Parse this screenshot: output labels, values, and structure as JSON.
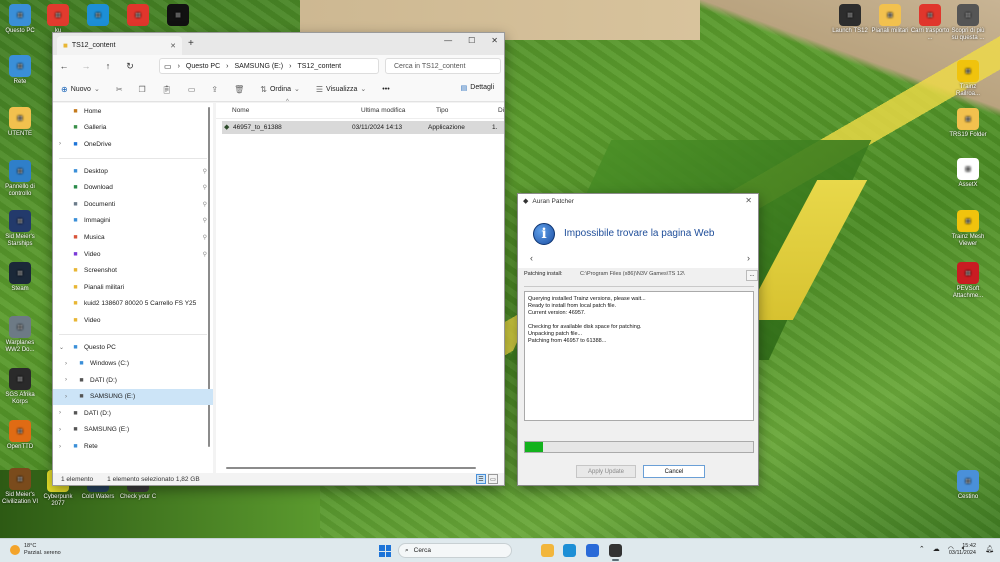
{
  "desktop": {
    "icons_left": [
      {
        "label": "Questo PC",
        "icon": "monitor-icon",
        "color": "#3a8fd8"
      },
      {
        "label": "Rete",
        "icon": "network-icon",
        "color": "#3a8fd8"
      },
      {
        "label": "UTENTE",
        "icon": "folder-icon",
        "color": "#f2c14e"
      },
      {
        "label": "Pannello di controllo",
        "icon": "control-panel-icon",
        "color": "#2f7fc9"
      },
      {
        "label": "Sid Meier's Starships",
        "icon": "starships-icon",
        "color": "#233a6b"
      },
      {
        "label": "Steam",
        "icon": "steam-icon",
        "color": "#1b2838"
      },
      {
        "label": "Warplanes WW2 Do...",
        "icon": "warplanes-icon",
        "color": "#6d7a85"
      },
      {
        "label": "SGS Afrika Korps",
        "icon": "sgs-icon",
        "color": "#2a2a2a"
      },
      {
        "label": "OpenTTD",
        "icon": "openttd-icon",
        "color": "#e06b14"
      },
      {
        "label": "Sid Meier's Civilization VI",
        "icon": "civ-icon",
        "color": "#7a4b1c"
      }
    ],
    "icons_top_row": [
      {
        "label": "ku",
        "icon": "anydesk-icon",
        "color": "#e23b2e"
      },
      {
        "label": "",
        "icon": "edge-icon",
        "color": "#1d8fd6"
      },
      {
        "label": "",
        "icon": "chrome-icon",
        "color": "#e0362c"
      },
      {
        "label": "",
        "icon": "logitech-icon",
        "color": "#111111"
      }
    ],
    "icons_bottom_row": [
      {
        "label": "Cyberpunk 2077",
        "icon": "cyberpunk-icon",
        "color": "#e9e12b"
      },
      {
        "label": "Cold Waters",
        "icon": "cold-waters-icon",
        "color": "#27435e"
      },
      {
        "label": "Check your C",
        "icon": "check-icon",
        "color": "#3b3b3b"
      }
    ],
    "icons_right": [
      {
        "label": "Launch TS12",
        "icon": "ts12-launcher-icon",
        "color": "#2d2d2d"
      },
      {
        "label": "Pianali militari",
        "icon": "folder-icon",
        "color": "#f2c14e"
      },
      {
        "label": "Carri trasporto ...",
        "icon": "chrome-icon",
        "color": "#e0362c"
      },
      {
        "label": "Scopri di più su questa ...",
        "icon": "spotlight-icon",
        "color": "#555555"
      },
      {
        "label": "Trainz Railroa...",
        "icon": "trainz-icon",
        "color": "#f0c30d"
      },
      {
        "label": "TRS19 Folder",
        "icon": "folder-icon",
        "color": "#f2c14e"
      },
      {
        "label": "AssetX",
        "icon": "assetx-icon",
        "color": "#ffffff"
      },
      {
        "label": "Trainz Mesh Viewer",
        "icon": "mesh-viewer-icon",
        "color": "#f0c30d"
      },
      {
        "label": "PEVSoft Attachme...",
        "icon": "pevsoft-icon",
        "color": "#c91c22"
      },
      {
        "label": "Cestino",
        "icon": "recycle-bin-icon",
        "color": "#4a90d9"
      }
    ]
  },
  "explorer": {
    "tab_title": "TS12_content",
    "breadcrumb": [
      "Questo PC",
      "SAMSUNG (E:)",
      "TS12_content"
    ],
    "search_placeholder": "Cerca in TS12_content",
    "toolbar": {
      "new": "Nuovo",
      "sort": "Ordina",
      "view": "Visualizza",
      "more": "•••",
      "details": "Dettagli"
    },
    "sidebar": [
      {
        "label": "Home",
        "icon": "home-icon",
        "chev": "",
        "pin": false,
        "color": "#c47a1c"
      },
      {
        "label": "Galleria",
        "icon": "gallery-icon",
        "chev": "",
        "pin": false,
        "color": "#3a8f4a"
      },
      {
        "label": "OneDrive",
        "icon": "onedrive-icon",
        "chev": "›",
        "pin": false,
        "color": "#1d74d8"
      },
      {
        "sep": true
      },
      {
        "label": "Desktop",
        "icon": "desktop-icon",
        "chev": "",
        "pin": true,
        "color": "#3a8fd8"
      },
      {
        "label": "Download",
        "icon": "download-icon",
        "chev": "",
        "pin": true,
        "color": "#2a8a4a"
      },
      {
        "label": "Documenti",
        "icon": "documents-icon",
        "chev": "",
        "pin": true,
        "color": "#6b7b8a"
      },
      {
        "label": "Immagini",
        "icon": "pictures-icon",
        "chev": "",
        "pin": true,
        "color": "#3a8fd8"
      },
      {
        "label": "Musica",
        "icon": "music-icon",
        "chev": "",
        "pin": true,
        "color": "#d8543a"
      },
      {
        "label": "Video",
        "icon": "video-icon",
        "chev": "",
        "pin": true,
        "color": "#7a3ad8"
      },
      {
        "label": "Screenshot",
        "icon": "folder-icon",
        "chev": "",
        "pin": false,
        "color": "#e8b634"
      },
      {
        "label": "Pianali militari",
        "icon": "folder-icon",
        "chev": "",
        "pin": false,
        "color": "#e8b634"
      },
      {
        "label": "kuid2 138607 80020 5 Carrello FS Y25",
        "icon": "folder-icon",
        "chev": "",
        "pin": false,
        "color": "#e8b634"
      },
      {
        "label": "Video",
        "icon": "folder-icon",
        "chev": "",
        "pin": false,
        "color": "#e8b634"
      },
      {
        "sep": true
      },
      {
        "label": "Questo PC",
        "icon": "pc-icon",
        "chev": "⌄",
        "pin": false,
        "color": "#3a8fd8"
      },
      {
        "label": "Windows (C:)",
        "icon": "drive-windows-icon",
        "chev": "›",
        "pin": false,
        "color": "#3a8fd8",
        "indent": 1
      },
      {
        "label": "DATI (D:)",
        "icon": "drive-icon",
        "chev": "›",
        "pin": false,
        "color": "#555555",
        "indent": 1
      },
      {
        "label": "SAMSUNG (E:)",
        "icon": "drive-icon",
        "chev": "›",
        "pin": false,
        "color": "#555555",
        "indent": 1,
        "selected": true
      },
      {
        "label": "DATI (D:)",
        "icon": "drive-icon",
        "chev": "›",
        "pin": false,
        "color": "#555555"
      },
      {
        "label": "SAMSUNG (E:)",
        "icon": "drive-icon",
        "chev": "›",
        "pin": false,
        "color": "#555555"
      },
      {
        "label": "Rete",
        "icon": "network-icon",
        "chev": "›",
        "pin": false,
        "color": "#3a8fd8"
      }
    ],
    "columns": {
      "name": "Nome",
      "modified": "Ultima modifica",
      "type": "Tipo",
      "size": "Di"
    },
    "files": [
      {
        "name": "46957_to_61388",
        "modified": "03/11/2024 14:13",
        "type": "Applicazione",
        "size": "1."
      }
    ],
    "status": {
      "count": "1 elemento",
      "selected": "1 elemento selezionato 1,82 GB"
    }
  },
  "patcher": {
    "title": "Auran Patcher",
    "headline": "Impossibile trovare la pagina Web",
    "patching_label": "Patching install:",
    "patching_path": "C:\\Program Files (x86)\\N3V Games\\TS 12\\",
    "browse": "...",
    "log": "Querying installed Trainz versions, please wait...\nReady to install from local patch file.\nCurrent version: 46957.\n\nChecking for available disk space for patching.\nUnpacking patch file...\nPatching from 46957 to 61388...",
    "progress": 0.08,
    "progress_color": "#13b21d",
    "apply_label": "Apply Update",
    "cancel_label": "Cancel"
  },
  "taskbar": {
    "weather_temp": "18°C",
    "weather_desc": "Parzial. sereno",
    "search_label": "Cerca",
    "apps": [
      {
        "name": "file-explorer-icon",
        "color": "#f2b63c"
      },
      {
        "name": "edge-icon",
        "color": "#1d8fd6"
      },
      {
        "name": "store-icon",
        "color": "#2a6ad8"
      },
      {
        "name": "ts12-icon",
        "color": "#333333"
      }
    ],
    "time": "15:42",
    "date": "03/11/2024"
  }
}
